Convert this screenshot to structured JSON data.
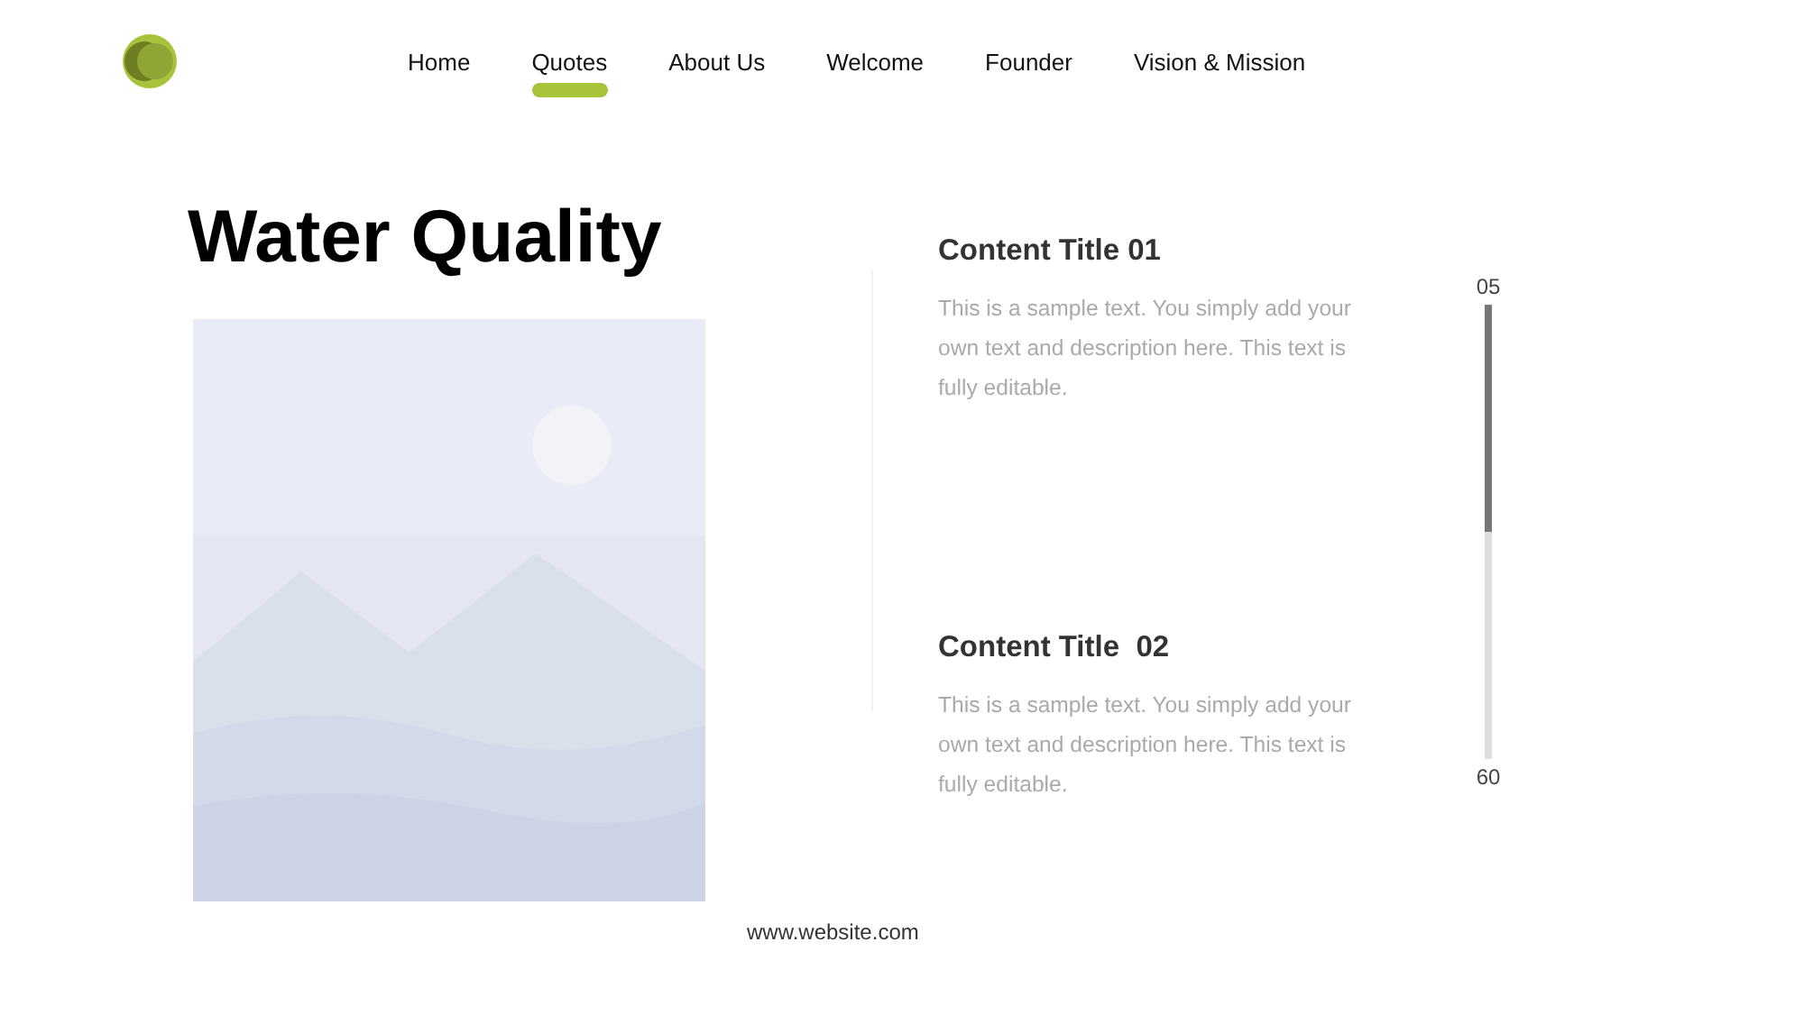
{
  "nav": [
    {
      "label": "Home",
      "selected": false
    },
    {
      "label": "Quotes",
      "selected": true
    },
    {
      "label": "About Us",
      "selected": false
    },
    {
      "label": "Welcome",
      "selected": false
    },
    {
      "label": "Founder",
      "selected": false
    },
    {
      "label": "Vision & Mission",
      "selected": false
    }
  ],
  "title": "Water Quality",
  "contents": [
    {
      "title": "Content Title 01",
      "text": "This is a sample text. You simply add your own text and description here. This text is fully editable."
    },
    {
      "title": "Content Title  02",
      "text": "This is a sample text. You simply add your own text and description here. This text is fully editable."
    }
  ],
  "progress": {
    "start": "05",
    "end": "60",
    "level": 0.5
  },
  "footer": "www.website.com"
}
